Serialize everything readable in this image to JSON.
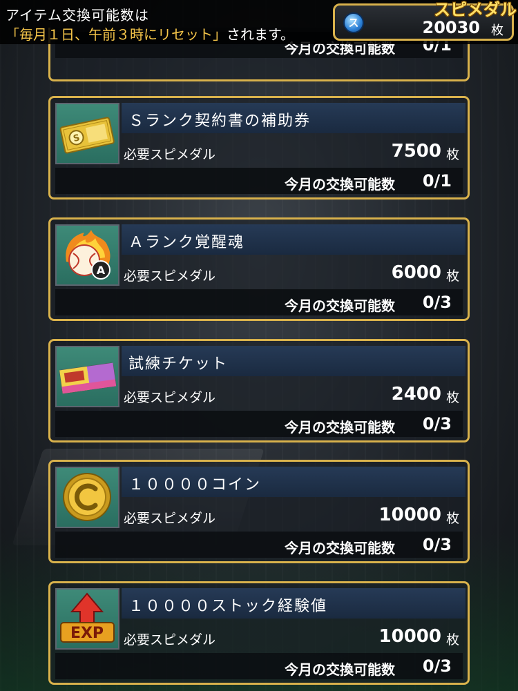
{
  "header": {
    "notice_line1": "アイテム交換可能数は",
    "notice_line2_highlight": "「毎月１日、午前３時にリセット」",
    "notice_line2_rest": "されます。",
    "medal_title": "スピメダル",
    "medal_icon": "ス",
    "medal_count": "20030",
    "medal_unit": "枚"
  },
  "labels": {
    "cost_label": "必要スピメダル",
    "unit": "枚",
    "limit_label": "今月の交換可能数"
  },
  "partial_item": {
    "limit": "0/1"
  },
  "items": [
    {
      "name": "Ｓランク契約書の補助券",
      "icon": "ticket-icon",
      "cost": "7500",
      "limit": "0/1"
    },
    {
      "name": "Ａランク覚醒魂",
      "icon": "awakening-ball-icon",
      "cost": "6000",
      "limit": "0/3"
    },
    {
      "name": "試練チケット",
      "icon": "trial-ticket-icon",
      "cost": "2400",
      "limit": "0/3"
    },
    {
      "name": "１００００コイン",
      "icon": "coin-icon",
      "cost": "10000",
      "limit": "0/3"
    },
    {
      "name": "１００００ストック経験値",
      "icon": "exp-icon",
      "cost": "10000",
      "limit": "0/3"
    }
  ],
  "colors": {
    "frame_gold": "#d9b24c",
    "highlight_text": "#f6c64a",
    "name_bar": "#1e3048"
  }
}
